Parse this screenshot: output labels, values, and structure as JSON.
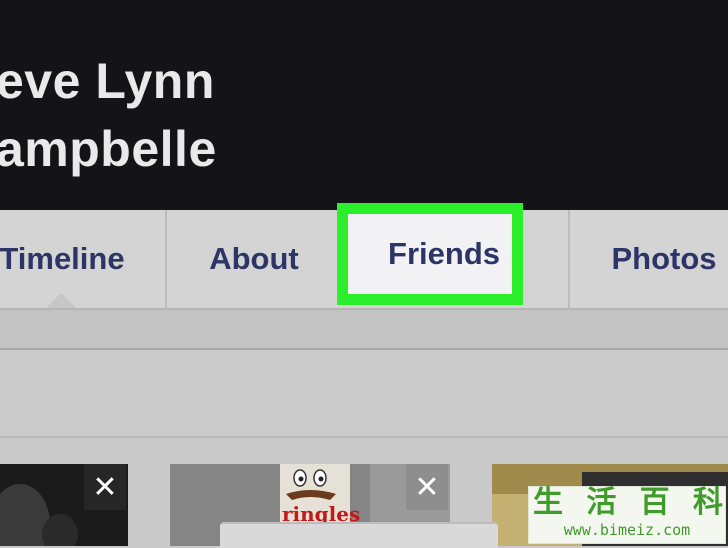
{
  "profile": {
    "name_line1": "eve Lynn",
    "name_line2": "ampbelle"
  },
  "tabs": [
    {
      "label": "Timeline",
      "active": true
    },
    {
      "label": "About",
      "active": false
    },
    {
      "label": "Friends",
      "active": false,
      "highlighted": true
    },
    {
      "label": "Photos",
      "active": false
    }
  ],
  "highlight_color": "#2bef2b",
  "cards": [
    {
      "close_label": "✕"
    },
    {
      "close_label": "✕",
      "partial_text": "ringles"
    },
    {
      "close_label": ""
    }
  ],
  "watermark": {
    "chars": [
      "生",
      "活",
      "百",
      "科"
    ],
    "url": "www.bimeiz.com"
  }
}
